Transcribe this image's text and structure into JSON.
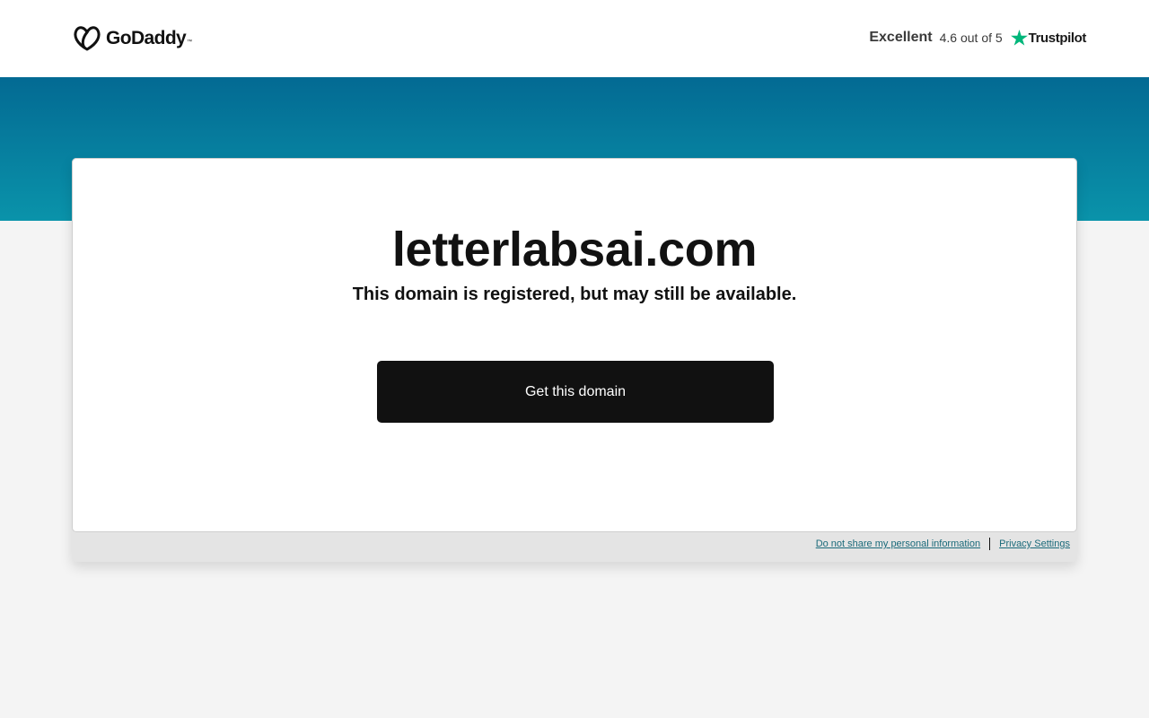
{
  "header": {
    "logo_text": "GoDaddy",
    "logo_tm": "™",
    "rating_label": "Excellent",
    "rating_score": "4.6 out of 5",
    "trustpilot": "Trustpilot",
    "trustpilot_color": "#00b67a"
  },
  "band": {
    "gradient_top": "#036a93",
    "gradient_bottom": "#0a93aa"
  },
  "main": {
    "domain": "letterlabsai.com",
    "subtitle": "This domain is registered, but may still be available.",
    "cta_label": "Get this domain"
  },
  "footer": {
    "do_not_share": "Do not share my personal information",
    "privacy_settings": "Privacy Settings"
  }
}
